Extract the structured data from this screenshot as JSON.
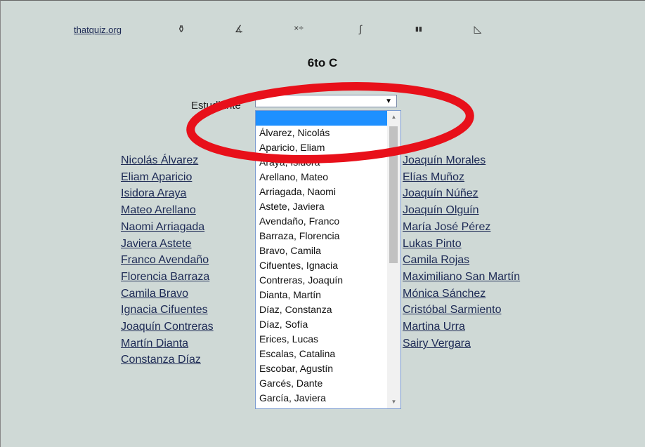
{
  "nav": {
    "logo": "thatquiz.org",
    "icons": [
      {
        "name": "fractions-icon",
        "glyph": "⚱"
      },
      {
        "name": "angle-icon",
        "glyph": "∡"
      },
      {
        "name": "arithmetic-icon",
        "glyph": "×÷"
      },
      {
        "name": "integral-icon",
        "glyph": "∫"
      },
      {
        "name": "statistics-icon",
        "glyph": "▮▮"
      },
      {
        "name": "geometry-icon",
        "glyph": "◺"
      }
    ]
  },
  "page": {
    "title": "6to C"
  },
  "form": {
    "student_label": "Estudiante",
    "selected_value": ""
  },
  "dropdown": {
    "options": [
      "",
      "Álvarez, Nicolás",
      "Aparicio, Eliam",
      "Araya, Isidora",
      "Arellano, Mateo",
      "Arriagada, Naomi",
      "Astete, Javiera",
      "Avendaño, Franco",
      "Barraza, Florencia",
      "Bravo, Camila",
      "Cifuentes, Ignacia",
      "Contreras, Joaquín",
      "Dianta, Martín",
      "Díaz, Constanza",
      "Díaz, Sofía",
      "Erices, Lucas",
      "Escalas, Catalina",
      "Escobar, Agustín",
      "Garcés, Dante",
      "García, Javiera"
    ]
  },
  "students_left": [
    "Nicolás Álvarez",
    "Eliam Aparicio",
    "Isidora Araya",
    "Mateo Arellano",
    "Naomi Arriagada",
    "Javiera Astete",
    "Franco Avendaño",
    "Florencia Barraza",
    "Camila Bravo",
    "Ignacia Cifuentes",
    "Joaquín Contreras",
    "Martín Dianta",
    "Constanza Díaz"
  ],
  "students_right": [
    "Joaquín Morales",
    "Elías Muñoz",
    "Joaquín Núñez",
    "Joaquín Olguín",
    "María José Pérez",
    "Lukas Pinto",
    "Camila Rojas",
    "Maximiliano San Martín",
    "Mónica Sánchez",
    "Cristóbal Sarmiento",
    "Martina Urra",
    "Sairy Vergara"
  ],
  "colors": {
    "background": "#cfd9d6",
    "link": "#1d2a55",
    "highlight": "#1e90ff",
    "annotation": "#e8101a"
  }
}
